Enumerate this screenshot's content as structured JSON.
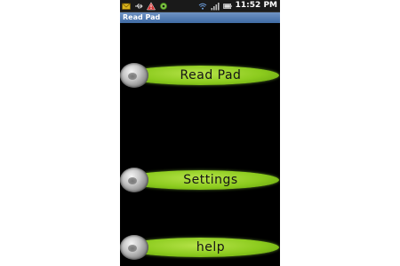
{
  "status_bar": {
    "time": "11:52 PM",
    "icons_left": [
      "mail-icon",
      "usb-icon",
      "warning-icon",
      "settings-gear-icon"
    ],
    "icons_right": [
      "wifi-icon",
      "signal-icon",
      "battery-icon"
    ]
  },
  "app": {
    "title": "Read Pad"
  },
  "menu": {
    "read_pad_label": "Read Pad",
    "settings_label": "Settings",
    "help_label": "help"
  },
  "colors": {
    "button_green": "#8ccb1e",
    "title_bar_blue": "#4f7ab4",
    "background": "#000000"
  }
}
